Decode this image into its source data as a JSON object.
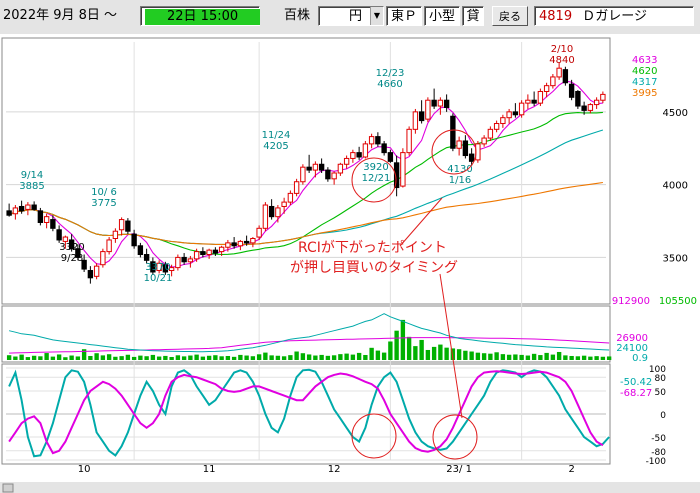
{
  "toolbar": {
    "start_date": "2022年  9月  8日 ～",
    "end_date": "22日 15:00",
    "price_label": "百株",
    "yen_label": "円",
    "market": "東Ｐ",
    "size": "小型",
    "lending": "貸",
    "back_button": "戻る",
    "code": "4819",
    "name": "Ｄガレージ",
    "colors": {
      "end_date_bg": "#22cc22",
      "code_text": "#c00000"
    }
  },
  "annotation": {
    "line1": "RCIが下がったポイント",
    "line2": "が押し目買いのタイミング",
    "color": "#e02020"
  },
  "chart_data": {
    "type": "candlestick",
    "x_labels": [
      "10",
      "11",
      "12",
      "23/ 1",
      "2"
    ],
    "price_axis": {
      "ticks": [
        3500,
        4000,
        4500
      ],
      "ylim": [
        3180,
        4980
      ]
    },
    "ma_legend": [
      {
        "value": "4633",
        "color": "#e000e0"
      },
      {
        "value": "4620",
        "color": "#00bb00"
      },
      {
        "value": "4317",
        "color": "#00aaaa"
      },
      {
        "value": "3995",
        "color": "#ee7700"
      }
    ],
    "price_annotations": [
      {
        "text": "9/14",
        "text2": "3885",
        "color": "#008888"
      },
      {
        "text": "10/ 6",
        "text2": "3775",
        "color": "#008888"
      },
      {
        "text": "3320",
        "text2": "9/28",
        "color": "#000000"
      },
      {
        "text": "3370",
        "text2": "10/21",
        "color": "#008888"
      },
      {
        "text": "11/24",
        "text2": "4205",
        "color": "#008888"
      },
      {
        "text": "12/23",
        "text2": "4660",
        "color": "#008888"
      },
      {
        "text": "3920",
        "text2": "12/21",
        "color": "#008888"
      },
      {
        "text": "4130",
        "text2": "1/16",
        "color": "#008888"
      },
      {
        "text": "2/10",
        "text2": "4840",
        "color": "#c00000"
      }
    ],
    "candles": [
      [
        3820,
        3870,
        3780,
        3790
      ],
      [
        3800,
        3860,
        3760,
        3840
      ],
      [
        3850,
        3890,
        3800,
        3820
      ],
      [
        3830,
        3880,
        3790,
        3860
      ],
      [
        3860,
        3885,
        3820,
        3830
      ],
      [
        3820,
        3840,
        3720,
        3740
      ],
      [
        3740,
        3800,
        3700,
        3780
      ],
      [
        3760,
        3790,
        3680,
        3700
      ],
      [
        3690,
        3720,
        3600,
        3620
      ],
      [
        3610,
        3650,
        3560,
        3640
      ],
      [
        3620,
        3660,
        3540,
        3560
      ],
      [
        3560,
        3590,
        3480,
        3500
      ],
      [
        3480,
        3520,
        3400,
        3420
      ],
      [
        3410,
        3440,
        3320,
        3360
      ],
      [
        3370,
        3460,
        3350,
        3440
      ],
      [
        3450,
        3560,
        3430,
        3540
      ],
      [
        3540,
        3640,
        3520,
        3620
      ],
      [
        3630,
        3700,
        3600,
        3680
      ],
      [
        3690,
        3775,
        3650,
        3760
      ],
      [
        3750,
        3770,
        3660,
        3680
      ],
      [
        3660,
        3690,
        3560,
        3580
      ],
      [
        3580,
        3600,
        3500,
        3520
      ],
      [
        3520,
        3560,
        3460,
        3480
      ],
      [
        3470,
        3500,
        3380,
        3400
      ],
      [
        3410,
        3480,
        3390,
        3460
      ],
      [
        3450,
        3470,
        3380,
        3400
      ],
      [
        3410,
        3450,
        3370,
        3430
      ],
      [
        3430,
        3520,
        3410,
        3500
      ],
      [
        3500,
        3530,
        3450,
        3470
      ],
      [
        3470,
        3510,
        3430,
        3490
      ],
      [
        3490,
        3560,
        3470,
        3540
      ],
      [
        3540,
        3570,
        3500,
        3520
      ],
      [
        3520,
        3560,
        3490,
        3550
      ],
      [
        3550,
        3570,
        3510,
        3530
      ],
      [
        3540,
        3580,
        3510,
        3570
      ],
      [
        3570,
        3620,
        3540,
        3600
      ],
      [
        3600,
        3640,
        3560,
        3580
      ],
      [
        3580,
        3620,
        3550,
        3610
      ],
      [
        3610,
        3650,
        3580,
        3600
      ],
      [
        3600,
        3640,
        3570,
        3630
      ],
      [
        3640,
        3720,
        3620,
        3700
      ],
      [
        3700,
        3880,
        3680,
        3860
      ],
      [
        3850,
        3900,
        3760,
        3780
      ],
      [
        3780,
        3860,
        3740,
        3840
      ],
      [
        3850,
        3910,
        3800,
        3880
      ],
      [
        3880,
        3960,
        3860,
        3940
      ],
      [
        3940,
        4040,
        3920,
        4020
      ],
      [
        4020,
        4140,
        4000,
        4120
      ],
      [
        4120,
        4205,
        4080,
        4100
      ],
      [
        4100,
        4160,
        4050,
        4140
      ],
      [
        4140,
        4180,
        4080,
        4100
      ],
      [
        4100,
        4120,
        4020,
        4040
      ],
      [
        4040,
        4090,
        4000,
        4080
      ],
      [
        4080,
        4150,
        4060,
        4140
      ],
      [
        4140,
        4200,
        4110,
        4180
      ],
      [
        4180,
        4240,
        4150,
        4220
      ],
      [
        4220,
        4260,
        4170,
        4190
      ],
      [
        4190,
        4300,
        4180,
        4280
      ],
      [
        4280,
        4350,
        4250,
        4330
      ],
      [
        4330,
        4360,
        4260,
        4280
      ],
      [
        4280,
        4300,
        4200,
        4220
      ],
      [
        4220,
        4240,
        4150,
        4160
      ],
      [
        4150,
        4200,
        3920,
        3980
      ],
      [
        3990,
        4250,
        3980,
        4220
      ],
      [
        4220,
        4400,
        4200,
        4380
      ],
      [
        4380,
        4520,
        4350,
        4500
      ],
      [
        4500,
        4580,
        4420,
        4440
      ],
      [
        4450,
        4600,
        4430,
        4580
      ],
      [
        4580,
        4660,
        4520,
        4540
      ],
      [
        4540,
        4600,
        4480,
        4580
      ],
      [
        4580,
        4620,
        4500,
        4530
      ],
      [
        4470,
        4490,
        4230,
        4250
      ],
      [
        4250,
        4330,
        4200,
        4300
      ],
      [
        4300,
        4340,
        4180,
        4200
      ],
      [
        4210,
        4250,
        4130,
        4160
      ],
      [
        4170,
        4300,
        4150,
        4280
      ],
      [
        4280,
        4340,
        4260,
        4320
      ],
      [
        4320,
        4400,
        4300,
        4380
      ],
      [
        4380,
        4440,
        4360,
        4420
      ],
      [
        4420,
        4480,
        4390,
        4460
      ],
      [
        4460,
        4520,
        4420,
        4500
      ],
      [
        4500,
        4560,
        4460,
        4480
      ],
      [
        4480,
        4580,
        4460,
        4560
      ],
      [
        4560,
        4620,
        4520,
        4580
      ],
      [
        4580,
        4640,
        4540,
        4560
      ],
      [
        4560,
        4660,
        4540,
        4640
      ],
      [
        4640,
        4700,
        4600,
        4680
      ],
      [
        4680,
        4760,
        4660,
        4740
      ],
      [
        4740,
        4840,
        4720,
        4800
      ],
      [
        4790,
        4810,
        4680,
        4700
      ],
      [
        4690,
        4720,
        4580,
        4600
      ],
      [
        4640,
        4650,
        4520,
        4540
      ],
      [
        4540,
        4570,
        4480,
        4510
      ],
      [
        4510,
        4560,
        4490,
        4550
      ],
      [
        4550,
        4600,
        4520,
        4580
      ],
      [
        4580,
        4640,
        4560,
        4620
      ]
    ],
    "volume": {
      "labels": [
        {
          "text": "912900",
          "color": "#e000e0"
        },
        {
          "text": "105500",
          "color": "#00bb00"
        },
        {
          "text": "26900",
          "color": "#e000e0"
        },
        {
          "text": "24100",
          "color": "#00aaaa"
        },
        {
          "text": "0.9",
          "color": "#00aaaa"
        }
      ],
      "ymax": 700,
      "bars": [
        62,
        45,
        70,
        38,
        55,
        48,
        90,
        44,
        72,
        36,
        58,
        46,
        140,
        52,
        88,
        60,
        75,
        42,
        50,
        68,
        40,
        57,
        49,
        66,
        45,
        53,
        39,
        61,
        47,
        58,
        70,
        44,
        55,
        62,
        48,
        52,
        41,
        66,
        58,
        49,
        74,
        96,
        60,
        55,
        48,
        63,
        110,
        88,
        72,
        58,
        66,
        54,
        61,
        76,
        83,
        70,
        92,
        65,
        158,
        122,
        96,
        240,
        380,
        520,
        300,
        180,
        260,
        130,
        170,
        200,
        160,
        150,
        140,
        120,
        110,
        95,
        88,
        82,
        100,
        76,
        68,
        72,
        66,
        58,
        80,
        64,
        92,
        70,
        104,
        60,
        52,
        48,
        56,
        44,
        50,
        42,
        46
      ],
      "lines": [
        {
          "color": "#e000e0",
          "values": [
            90,
            92,
            94,
            96,
            98,
            100,
            102,
            104,
            105,
            106,
            108,
            110,
            112,
            114,
            116,
            118,
            120,
            122,
            123,
            124,
            126,
            128,
            130,
            132,
            134,
            136,
            138,
            140,
            142,
            144,
            146,
            148,
            150,
            155,
            160,
            170,
            180,
            190,
            200,
            210,
            220,
            230,
            235,
            240,
            245,
            250,
            252,
            254,
            256,
            258,
            260,
            262,
            264,
            266,
            268,
            270,
            272,
            274,
            276,
            278,
            280,
            282,
            284,
            286,
            288,
            290,
            290,
            290,
            290,
            290,
            290,
            289,
            288,
            287,
            286,
            285,
            284,
            283,
            282,
            281,
            280,
            278,
            276,
            274,
            272,
            270,
            266,
            262,
            258,
            254,
            250,
            245,
            240,
            235,
            230,
            225,
            220
          ]
        },
        {
          "color": "#00aaaa",
          "values": [
            380,
            360,
            340,
            330,
            320,
            300,
            280,
            260,
            250,
            240,
            230,
            220,
            210,
            200,
            190,
            180,
            170,
            160,
            150,
            140,
            135,
            130,
            125,
            120,
            118,
            116,
            114,
            112,
            110,
            110,
            108,
            108,
            110,
            112,
            115,
            120,
            128,
            140,
            150,
            160,
            175,
            190,
            210,
            230,
            250,
            270,
            280,
            290,
            300,
            320,
            340,
            360,
            380,
            400,
            420,
            440,
            470,
            500,
            520,
            560,
            600,
            560,
            530,
            500,
            470,
            440,
            410,
            390,
            370,
            350,
            320,
            300,
            280,
            270,
            260,
            250,
            240,
            232,
            224,
            216,
            208,
            200,
            194,
            188,
            182,
            176,
            170,
            166,
            162,
            158,
            154,
            150,
            146,
            142,
            138,
            134,
            130
          ]
        }
      ]
    },
    "rci": {
      "ticks": [
        100,
        80,
        50,
        0,
        -50,
        -80,
        -100
      ],
      "labels": [
        {
          "text": "-50.42",
          "color": "#00aaaa"
        },
        {
          "text": "-68.27",
          "color": "#e000e0"
        }
      ],
      "series": [
        {
          "color": "#00aaaa",
          "values": [
            60,
            90,
            30,
            -50,
            -92,
            -90,
            -60,
            -20,
            30,
            80,
            95,
            92,
            70,
            20,
            -40,
            -60,
            -80,
            -90,
            -70,
            -40,
            0,
            40,
            70,
            50,
            20,
            0,
            60,
            90,
            95,
            85,
            60,
            40,
            20,
            30,
            50,
            70,
            90,
            95,
            90,
            70,
            40,
            0,
            -30,
            -40,
            -10,
            40,
            80,
            95,
            96,
            92,
            70,
            40,
            10,
            -10,
            -30,
            -50,
            -60,
            -30,
            20,
            60,
            80,
            90,
            70,
            30,
            -10,
            -40,
            -60,
            -70,
            -75,
            -78,
            -75,
            -60,
            -40,
            -20,
            0,
            20,
            40,
            70,
            90,
            95,
            93,
            90,
            80,
            90,
            95,
            92,
            80,
            60,
            40,
            10,
            -10,
            -30,
            -50,
            -60,
            -70,
            -65,
            -50
          ]
        },
        {
          "color": "#e000e0",
          "values": [
            -60,
            -40,
            -20,
            -10,
            -5,
            -20,
            -60,
            -85,
            -80,
            -60,
            -30,
            0,
            30,
            50,
            60,
            70,
            65,
            55,
            40,
            20,
            0,
            -20,
            -30,
            -20,
            0,
            40,
            70,
            80,
            85,
            82,
            80,
            75,
            70,
            65,
            55,
            50,
            48,
            50,
            55,
            60,
            60,
            55,
            50,
            45,
            40,
            35,
            30,
            30,
            45,
            60,
            70,
            80,
            85,
            88,
            86,
            82,
            76,
            70,
            65,
            55,
            30,
            0,
            -20,
            -40,
            -60,
            -74,
            -80,
            -82,
            -78,
            -70,
            -55,
            -30,
            0,
            30,
            60,
            80,
            90,
            92,
            93,
            92,
            90,
            88,
            87,
            88,
            90,
            92,
            90,
            85,
            80,
            70,
            50,
            20,
            -10,
            -40,
            -60,
            -68
          ]
        }
      ]
    }
  }
}
